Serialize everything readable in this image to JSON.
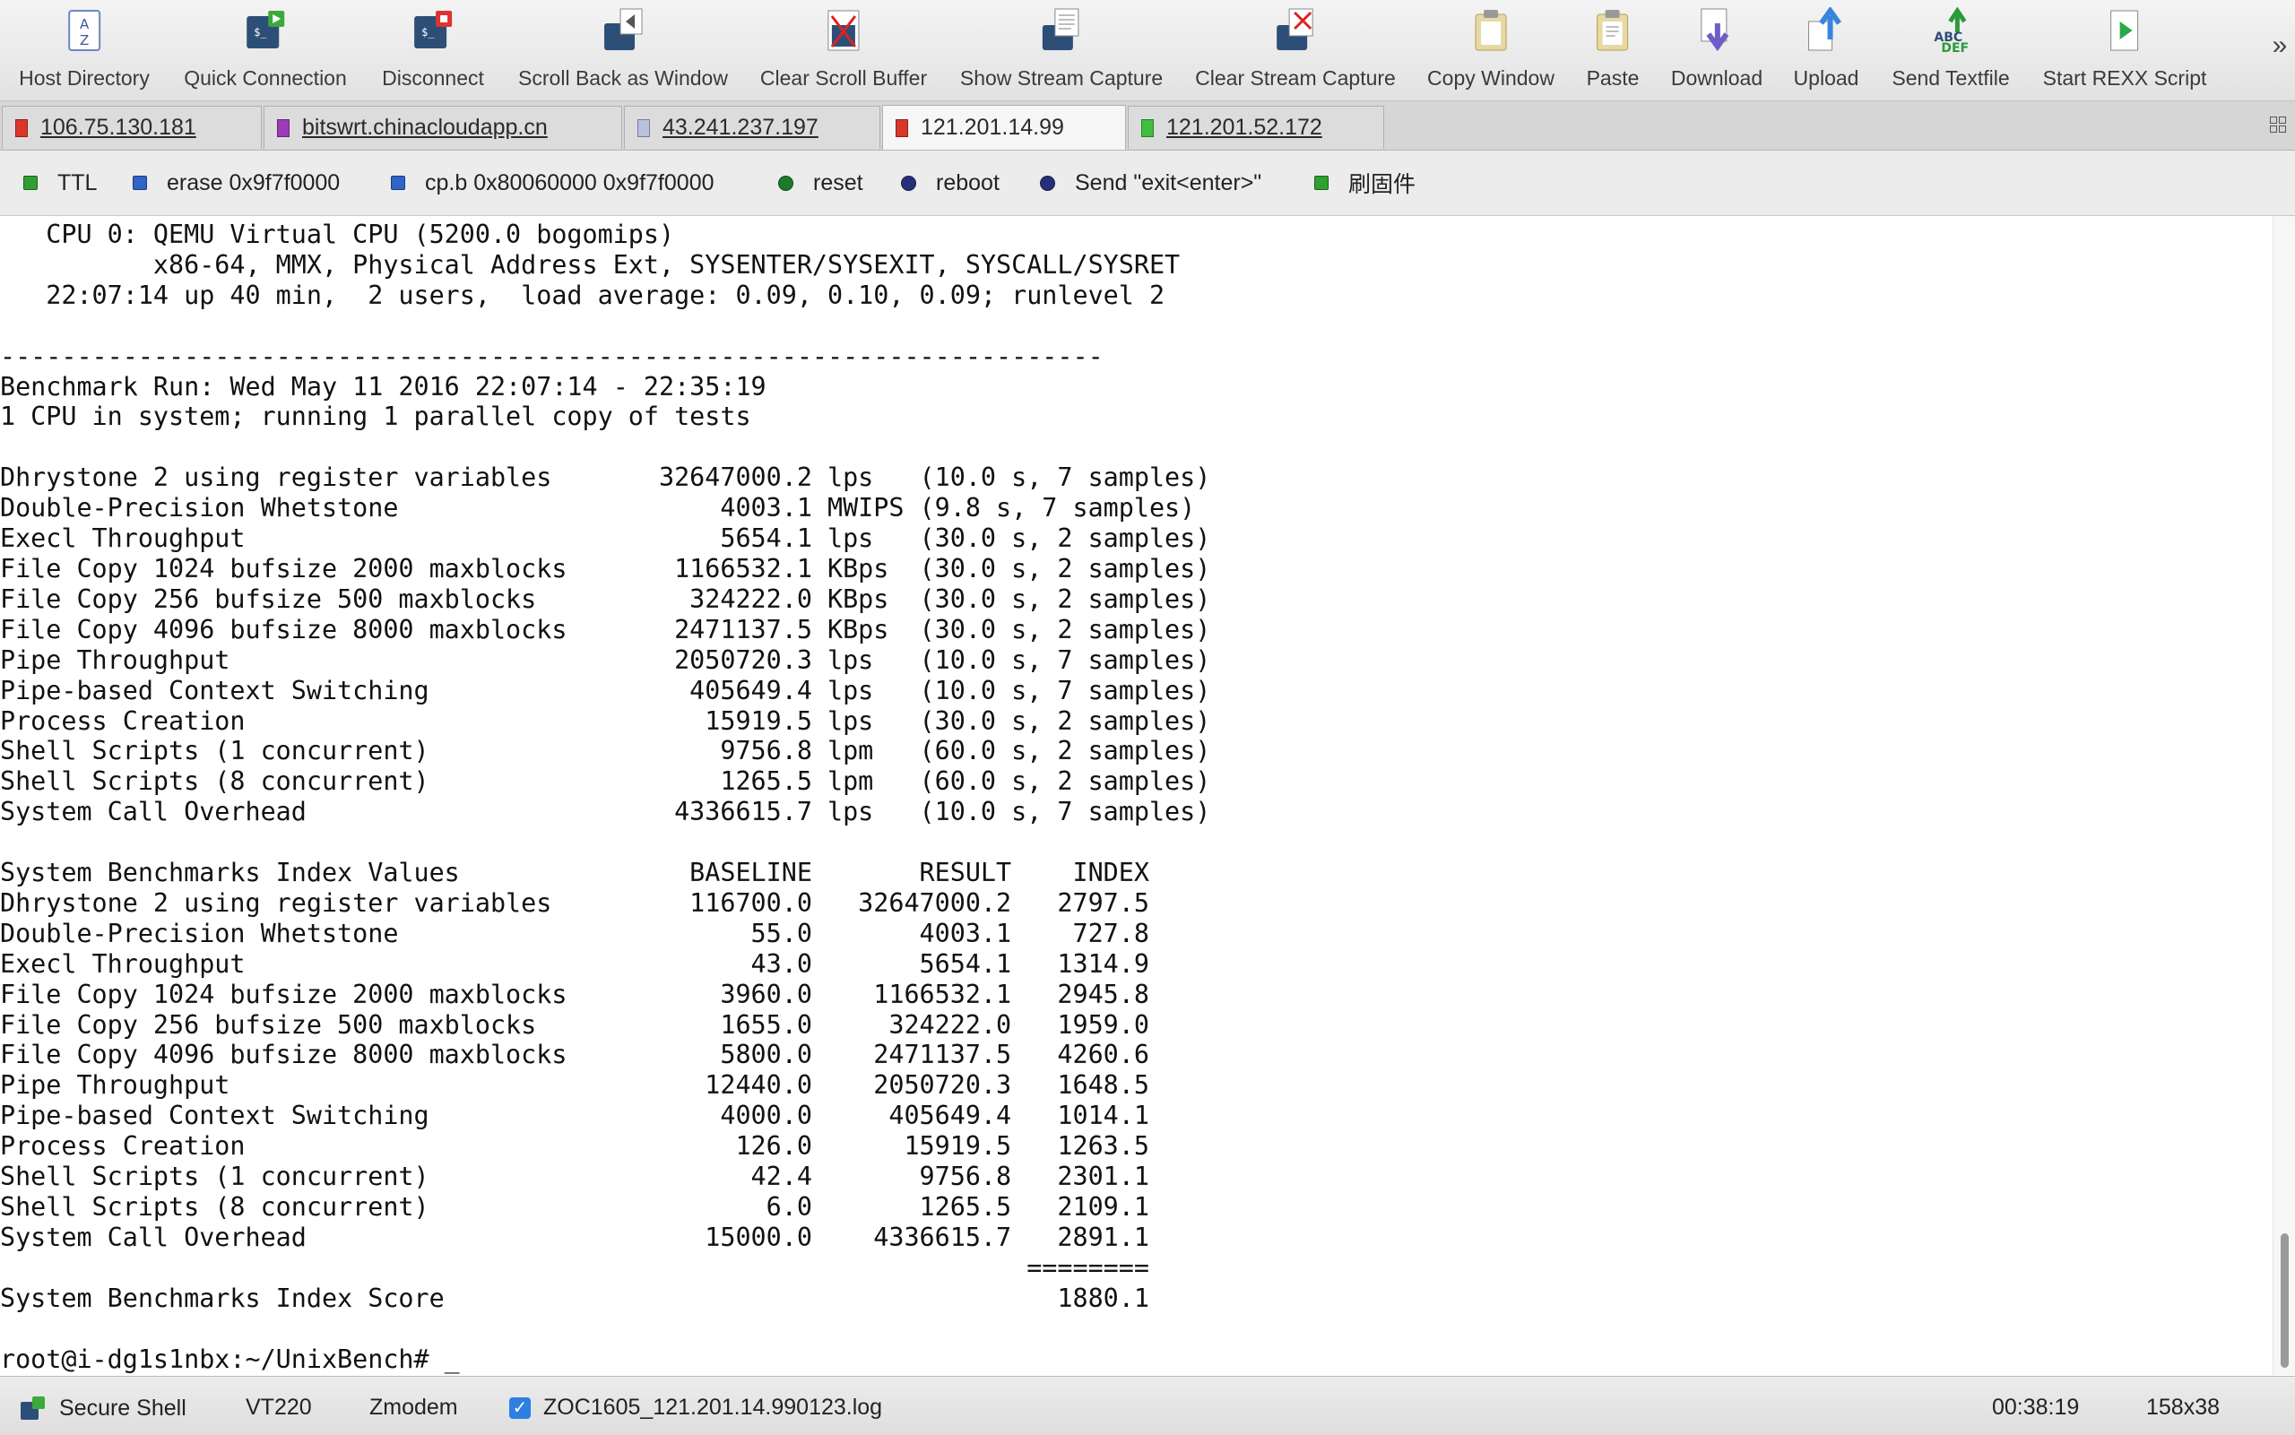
{
  "toolbar": {
    "buttons": [
      {
        "label": "Host Directory",
        "icon": "host-directory-icon"
      },
      {
        "label": "Quick Connection",
        "icon": "quick-connection-icon"
      },
      {
        "label": "Disconnect",
        "icon": "disconnect-icon"
      },
      {
        "label": "Scroll Back as Window",
        "icon": "scroll-back-icon"
      },
      {
        "label": "Clear Scroll Buffer",
        "icon": "clear-scroll-buffer-icon"
      },
      {
        "label": "Show Stream Capture",
        "icon": "show-stream-capture-icon"
      },
      {
        "label": "Clear Stream Capture",
        "icon": "clear-stream-capture-icon"
      },
      {
        "label": "Copy Window",
        "icon": "copy-window-icon"
      },
      {
        "label": "Paste",
        "icon": "paste-icon"
      },
      {
        "label": "Download",
        "icon": "download-icon"
      },
      {
        "label": "Upload",
        "icon": "upload-icon"
      },
      {
        "label": "Send Textfile",
        "icon": "send-textfile-icon"
      },
      {
        "label": "Start REXX Script",
        "icon": "rexx-script-icon"
      }
    ],
    "overflow_label": "»",
    "host_icon_letters": [
      "A",
      "Z"
    ],
    "send_textfile_icon_letters": [
      "ABC",
      "DEF"
    ]
  },
  "tabs": [
    {
      "label": "106.75.130.181",
      "color": "#d9372b",
      "active": false
    },
    {
      "label": "bitswrt.chinacloudapp.cn",
      "color": "#9b3bb8",
      "active": false
    },
    {
      "label": "43.241.237.197",
      "color": "#b9c0e0",
      "active": false
    },
    {
      "label": "121.201.14.99",
      "color": "#d9372b",
      "active": true
    },
    {
      "label": "121.201.52.172",
      "color": "#3fbf3f",
      "active": false
    }
  ],
  "macros": [
    {
      "label": "TTL",
      "shape": "square",
      "color": "#2fa02f"
    },
    {
      "label": "erase 0x9f7f0000",
      "shape": "square",
      "color": "#2f64c8"
    },
    {
      "label": "cp.b 0x80060000 0x9f7f0000",
      "shape": "square",
      "color": "#2f64c8"
    },
    {
      "label": "reset",
      "shape": "round",
      "color": "#1d7a2a"
    },
    {
      "label": "reboot",
      "shape": "round",
      "color": "#24307a"
    },
    {
      "label": "Send \"exit<enter>\"",
      "shape": "round",
      "color": "#24307a"
    },
    {
      "label": "刷固件",
      "shape": "square",
      "color": "#2fa02f"
    }
  ],
  "terminal": {
    "lines": [
      "   CPU 0: QEMU Virtual CPU (5200.0 bogomips)",
      "          x86-64, MMX, Physical Address Ext, SYSENTER/SYSEXIT, SYSCALL/SYSRET",
      "   22:07:14 up 40 min,  2 users,  load average: 0.09, 0.10, 0.09; runlevel 2",
      "",
      "------------------------------------------------------------------------",
      "Benchmark Run: Wed May 11 2016 22:07:14 - 22:35:19",
      "1 CPU in system; running 1 parallel copy of tests",
      "",
      "Dhrystone 2 using register variables       32647000.2 lps   (10.0 s, 7 samples)",
      "Double-Precision Whetstone                     4003.1 MWIPS (9.8 s, 7 samples)",
      "Execl Throughput                               5654.1 lps   (30.0 s, 2 samples)",
      "File Copy 1024 bufsize 2000 maxblocks       1166532.1 KBps  (30.0 s, 2 samples)",
      "File Copy 256 bufsize 500 maxblocks          324222.0 KBps  (30.0 s, 2 samples)",
      "File Copy 4096 bufsize 8000 maxblocks       2471137.5 KBps  (30.0 s, 2 samples)",
      "Pipe Throughput                             2050720.3 lps   (10.0 s, 7 samples)",
      "Pipe-based Context Switching                 405649.4 lps   (10.0 s, 7 samples)",
      "Process Creation                              15919.5 lps   (30.0 s, 2 samples)",
      "Shell Scripts (1 concurrent)                   9756.8 lpm   (60.0 s, 2 samples)",
      "Shell Scripts (8 concurrent)                   1265.5 lpm   (60.0 s, 2 samples)",
      "System Call Overhead                        4336615.7 lps   (10.0 s, 7 samples)",
      "",
      "System Benchmarks Index Values               BASELINE       RESULT    INDEX",
      "Dhrystone 2 using register variables         116700.0   32647000.2   2797.5",
      "Double-Precision Whetstone                       55.0       4003.1    727.8",
      "Execl Throughput                                 43.0       5654.1   1314.9",
      "File Copy 1024 bufsize 2000 maxblocks          3960.0    1166532.1   2945.8",
      "File Copy 256 bufsize 500 maxblocks            1655.0     324222.0   1959.0",
      "File Copy 4096 bufsize 8000 maxblocks          5800.0    2471137.5   4260.6",
      "Pipe Throughput                               12440.0    2050720.3   1648.5",
      "Pipe-based Context Switching                   4000.0     405649.4   1014.1",
      "Process Creation                                126.0      15919.5   1263.5",
      "Shell Scripts (1 concurrent)                     42.4       9756.8   2301.1",
      "Shell Scripts (8 concurrent)                      6.0       1265.5   2109.1",
      "System Call Overhead                          15000.0    4336615.7   2891.1",
      "                                                                   ========",
      "System Benchmarks Index Score                                        1880.1",
      "",
      "root@i-dg1s1nbx:~/UnixBench# _"
    ]
  },
  "statusbar": {
    "protocol": "Secure Shell",
    "emulation": "VT220",
    "transfer": "Zmodem",
    "logfile": "ZOC1605_121.201.14.990123.log",
    "log_checked": true,
    "check_mark": "✓",
    "elapsed": "00:38:19",
    "size": "158x38"
  },
  "colors": {
    "toolbar_bg": "#e8e8e8",
    "active_tab_bg": "#f6f6f6",
    "terminal_bg": "#ffffff",
    "terminal_fg": "#111111"
  }
}
